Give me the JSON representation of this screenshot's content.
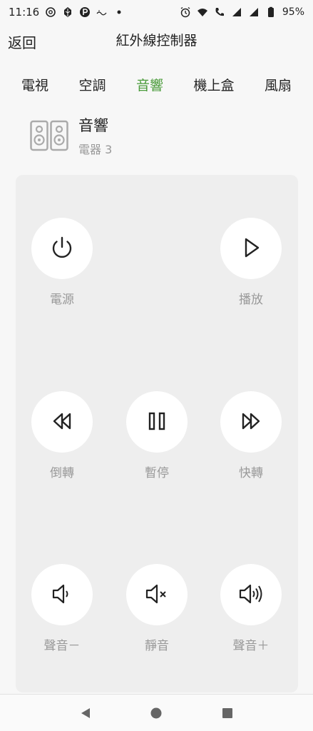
{
  "status_bar": {
    "time": "11:16",
    "battery": "95%",
    "left_icons": [
      "threads-icon",
      "leaf-icon",
      "parking-icon",
      "text-notify-icon",
      "dot-icon"
    ],
    "right_icons": [
      "alarm-icon",
      "wifi-icon",
      "call-icon",
      "signal-icon",
      "signal-icon",
      "battery-icon"
    ]
  },
  "header": {
    "back_label": "返回",
    "title": "紅外線控制器"
  },
  "tabs": {
    "items": [
      {
        "label": "電視",
        "active": false
      },
      {
        "label": "空調",
        "active": false
      },
      {
        "label": "音響",
        "active": true
      },
      {
        "label": "機上盒",
        "active": false
      },
      {
        "label": "風扇",
        "active": false
      }
    ]
  },
  "device": {
    "name": "音響",
    "subtitle": "電器 3",
    "icon": "speaker-icon"
  },
  "remote": {
    "power": {
      "label": "電源",
      "icon": "power-icon"
    },
    "play": {
      "label": "播放",
      "icon": "play-icon"
    },
    "rewind": {
      "label": "倒轉",
      "icon": "rewind-icon"
    },
    "pause": {
      "label": "暫停",
      "icon": "pause-icon"
    },
    "fast_forward": {
      "label": "快轉",
      "icon": "fast-forward-icon"
    },
    "volume_down": {
      "label": "聲音－",
      "icon": "volume-low-icon"
    },
    "mute": {
      "label": "靜音",
      "icon": "mute-icon"
    },
    "volume_up": {
      "label": "聲音＋",
      "icon": "volume-high-icon"
    }
  },
  "nav_bar": {
    "items": [
      "back-triangle-icon",
      "home-circle-icon",
      "recents-square-icon"
    ]
  },
  "colors": {
    "accent": "#4a9b3a",
    "panel": "#eeeeee",
    "background": "#f7f7f7",
    "label_gray": "#999999"
  }
}
